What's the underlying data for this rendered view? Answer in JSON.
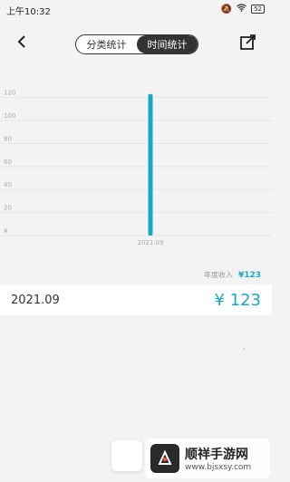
{
  "status_bar": {
    "time": "上午10:32",
    "battery": "52",
    "icons": [
      "mute-icon",
      "wifi-icon",
      "battery-icon"
    ]
  },
  "header": {
    "tabs": [
      {
        "label": "分类统计",
        "active": false
      },
      {
        "label": "时间统计",
        "active": true
      }
    ],
    "icons": [
      "back-icon",
      "share-icon"
    ]
  },
  "chart_data": {
    "type": "bar",
    "categories": [
      "2021.09"
    ],
    "values": [
      123
    ],
    "y_ticks": [
      "¥",
      "20",
      "40",
      "60",
      "80",
      "100",
      "120"
    ],
    "ylim": [
      0,
      126
    ],
    "bar_color": "#1aa7c4",
    "grid": true
  },
  "yearly": {
    "label": "年度收入",
    "value": "¥123"
  },
  "month_row": {
    "month": "2021.09",
    "amount": "¥ 123"
  },
  "watermark": {
    "title": "顺祥手游网",
    "url": "www.bjsxsy.com"
  },
  "colors": {
    "accent": "#1aa7c4",
    "segment_active": "#333333"
  }
}
